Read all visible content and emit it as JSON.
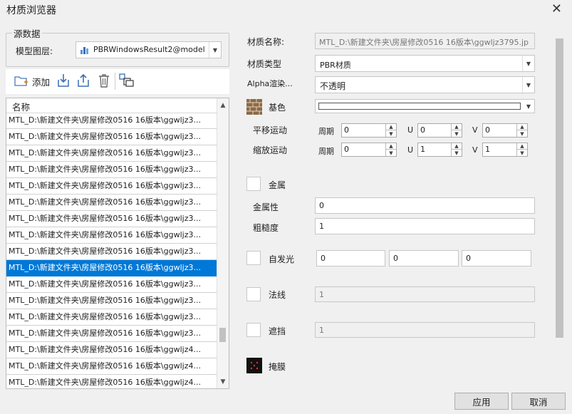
{
  "window": {
    "title": "材质浏览器",
    "close_glyph": "✕"
  },
  "source": {
    "group_label": "源数据",
    "layer_label": "模型图层:",
    "layer_value": "PBRWindowsResult2@model",
    "layer_icon": "model-layer-icon"
  },
  "toolbar": {
    "add_label": "添加"
  },
  "list": {
    "header": "名称",
    "items": [
      "MTL_D:\\新建文件夹\\房屋修改0516  16版本\\ggwljz3...",
      "MTL_D:\\新建文件夹\\房屋修改0516  16版本\\ggwljz3...",
      "MTL_D:\\新建文件夹\\房屋修改0516  16版本\\ggwljz3...",
      "MTL_D:\\新建文件夹\\房屋修改0516  16版本\\ggwljz3...",
      "MTL_D:\\新建文件夹\\房屋修改0516  16版本\\ggwljz3...",
      "MTL_D:\\新建文件夹\\房屋修改0516  16版本\\ggwljz3...",
      "MTL_D:\\新建文件夹\\房屋修改0516  16版本\\ggwljz3...",
      "MTL_D:\\新建文件夹\\房屋修改0516  16版本\\ggwljz3...",
      "MTL_D:\\新建文件夹\\房屋修改0516  16版本\\ggwljz3...",
      "MTL_D:\\新建文件夹\\房屋修改0516  16版本\\ggwljz3...",
      "MTL_D:\\新建文件夹\\房屋修改0516  16版本\\ggwljz3...",
      "MTL_D:\\新建文件夹\\房屋修改0516  16版本\\ggwljz3...",
      "MTL_D:\\新建文件夹\\房屋修改0516  16版本\\ggwljz3...",
      "MTL_D:\\新建文件夹\\房屋修改0516  16版本\\ggwljz3...",
      "MTL_D:\\新建文件夹\\房屋修改0516  16版本\\ggwljz4...",
      "MTL_D:\\新建文件夹\\房屋修改0516  16版本\\ggwljz4...",
      "MTL_D:\\新建文件夹\\房屋修改0516  16版本\\ggwljz4..."
    ],
    "selected_index": 9
  },
  "props": {
    "name_label": "材质名称:",
    "name_value": "MTL_D:\\新建文件夹\\房屋修改0516  16版本\\ggwljz3795.jp",
    "type_label": "材质类型",
    "type_value": "PBR材质",
    "alpha_label": "Alpha渲染...",
    "alpha_value": "不透明",
    "base_label": "基色",
    "pan_label": "平移运动",
    "scale_label": "缩放运动",
    "period_label": "周期",
    "u_label": "U",
    "v_label": "V",
    "pan": {
      "period": "0",
      "u": "0",
      "v": "0"
    },
    "scale": {
      "period": "0",
      "u": "1",
      "v": "1"
    },
    "metal_label": "金属",
    "metalness_label": "金属性",
    "metalness_value": "0",
    "roughness_label": "粗糙度",
    "roughness_value": "1",
    "emissive_label": "自发光",
    "emissive": [
      "0",
      "0",
      "0"
    ],
    "normal_label": "法线",
    "normal_value": "1",
    "occlusion_label": "遮挡",
    "occlusion_value": "1",
    "mask_label": "掩膜"
  },
  "buttons": {
    "apply": "应用",
    "cancel": "取消"
  },
  "colors": {
    "selection": "#0078d7",
    "background": "#f0f0f0"
  }
}
